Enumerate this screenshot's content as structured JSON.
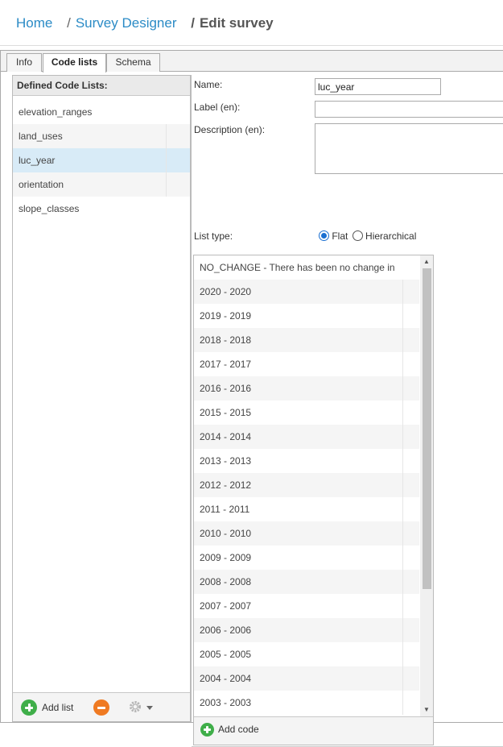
{
  "breadcrumb": {
    "home": "Home",
    "sep1": "/",
    "survey_designer": "Survey Designer",
    "sep2": "/",
    "current": "Edit survey"
  },
  "tabs": [
    "Info",
    "Code lists",
    "Schema"
  ],
  "active_tab": "Code lists",
  "left": {
    "header": "Defined Code Lists:",
    "items": [
      "elevation_ranges",
      "land_uses",
      "luc_year",
      "orientation",
      "slope_classes"
    ],
    "selected": "luc_year",
    "add_list_label": "Add list"
  },
  "form": {
    "name_label": "Name:",
    "name_value": "luc_year",
    "label_label": "Label (en):",
    "label_value": "",
    "description_label": "Description (en):",
    "description_value": "",
    "list_type_label": "List type:",
    "list_type_options": [
      "Flat",
      "Hierarchical"
    ],
    "list_type_selected": "Flat"
  },
  "codes": {
    "items": [
      "NO_CHANGE - There has been no change in",
      "2020 - 2020",
      "2019 - 2019",
      "2018 - 2018",
      "2017 - 2017",
      "2016 - 2016",
      "2015 - 2015",
      "2014 - 2014",
      "2013 - 2013",
      "2012 - 2012",
      "2011 - 2011",
      "2010 - 2010",
      "2009 - 2009",
      "2008 - 2008",
      "2007 - 2007",
      "2006 - 2006",
      "2005 - 2005",
      "2004 - 2004",
      "2003 - 2003"
    ],
    "add_code_label": "Add code"
  },
  "colors": {
    "link": "#2b8bc6",
    "selected_row": "#d8ebf7",
    "add_green": "#3fae49",
    "remove_orange": "#ef7a22"
  },
  "icons": [
    "plus-circle-icon",
    "minus-circle-icon",
    "gear-icon",
    "caret-down-icon",
    "scroll-up-arrow-icon",
    "scroll-down-arrow-icon"
  ]
}
